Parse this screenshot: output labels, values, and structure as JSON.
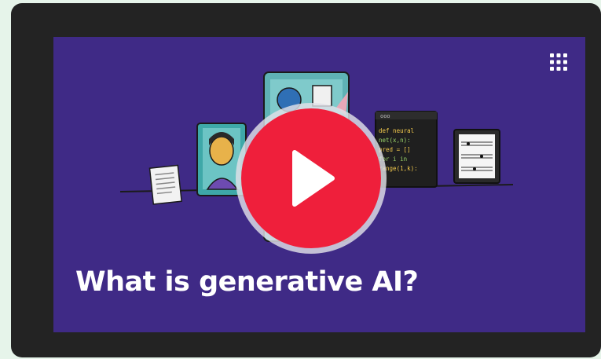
{
  "video": {
    "title": "What is generative AI?",
    "code_lines": [
      "def neural",
      "net(x,n):",
      "pred = []",
      "for i in",
      "range(1,k):"
    ],
    "code_header": "ooo"
  },
  "icons": {
    "play": "play-icon",
    "logo": "dot-grid-logo-icon"
  },
  "colors": {
    "page_bg": "#e6f4ea",
    "frame_bg": "#232323",
    "video_bg": "#3f2a86",
    "play_red": "#ef1f3b",
    "title_text": "#ffffff"
  }
}
